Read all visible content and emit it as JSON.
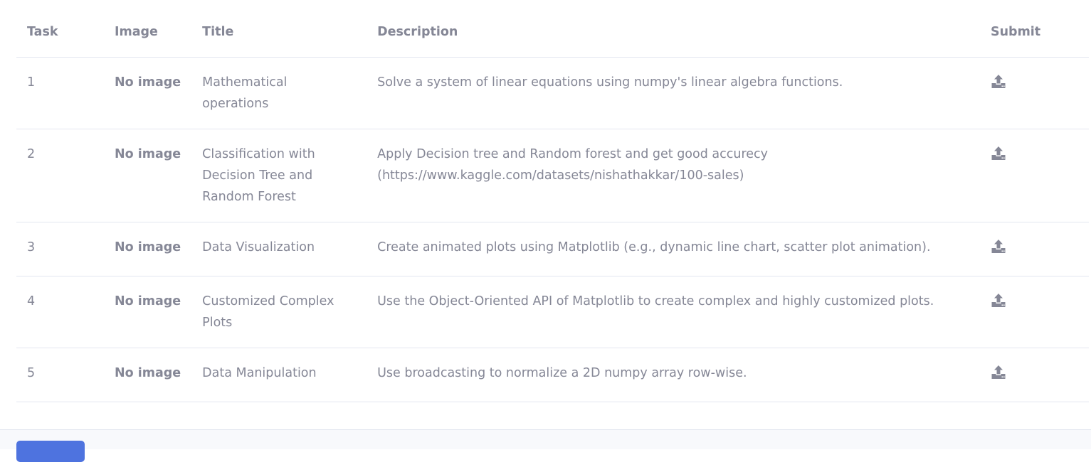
{
  "table": {
    "headers": {
      "task": "Task",
      "image": "Image",
      "title": "Title",
      "description": "Description",
      "submit": "Submit"
    },
    "rows": [
      {
        "task": "1",
        "image": "No image",
        "title": "Mathematical operations",
        "description": "Solve a system of linear equations using numpy's linear algebra functions.",
        "submit_icon": "upload-icon"
      },
      {
        "task": "2",
        "image": "No image",
        "title": "Classification with Decision Tree and Random Forest",
        "description": "Apply Decision tree and Random forest and get good accurecy (https://www.kaggle.com/datasets/nishathakkar/100-sales)",
        "submit_icon": "upload-icon"
      },
      {
        "task": "3",
        "image": "No image",
        "title": "Data Visualization",
        "description": "Create animated plots using Matplotlib (e.g., dynamic line chart, scatter plot animation).",
        "submit_icon": "upload-icon"
      },
      {
        "task": "4",
        "image": "No image",
        "title": "Customized Complex Plots",
        "description": "Use the Object-Oriented API of Matplotlib to create complex and highly customized plots.",
        "submit_icon": "upload-icon"
      },
      {
        "task": "5",
        "image": "No image",
        "title": "Data Manipulation",
        "description": "Use broadcasting to normalize a 2D numpy array row-wise.",
        "submit_icon": "upload-icon"
      }
    ]
  },
  "colors": {
    "text": "#858796",
    "border": "#e3e6f0",
    "footer_bg": "#f8f9fc",
    "primary": "#4e73df"
  }
}
